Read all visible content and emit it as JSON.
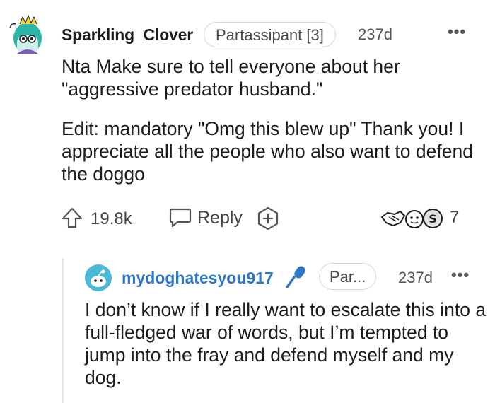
{
  "comment1": {
    "username": "Sparkling_Clover",
    "flair": "Partassipant [3]",
    "age": "237d",
    "more": "•••",
    "paragraph1": "Nta Make sure to tell everyone about her \"aggressive predator husband.\"",
    "paragraph2": "Edit: mandatory \"Omg this blew up\" Thank you! I appreciate all the people who also want to defend the doggo",
    "score": "19.8k",
    "reply_label": "Reply",
    "award_count": "7",
    "avatar_icon": "avatar-icon",
    "upvote_icon": "upvote-arrow-icon",
    "reply_icon": "speech-bubble-icon",
    "award_icon": "add-award-icon"
  },
  "comment2": {
    "username": "mydoghatesyou917",
    "flair": "Par...",
    "age": "237d",
    "more": "•••",
    "paragraph1": "I don’t know if I really want to escalate this into a full-fledged war of words, but I’m tempted to jump into the fray and defend myself and my dog.",
    "op_icon": "microphone-icon"
  },
  "colors": {
    "username_op": "#2f76c4",
    "text": "#1c1c1c",
    "muted": "#555555",
    "border": "#d7d7d7"
  }
}
